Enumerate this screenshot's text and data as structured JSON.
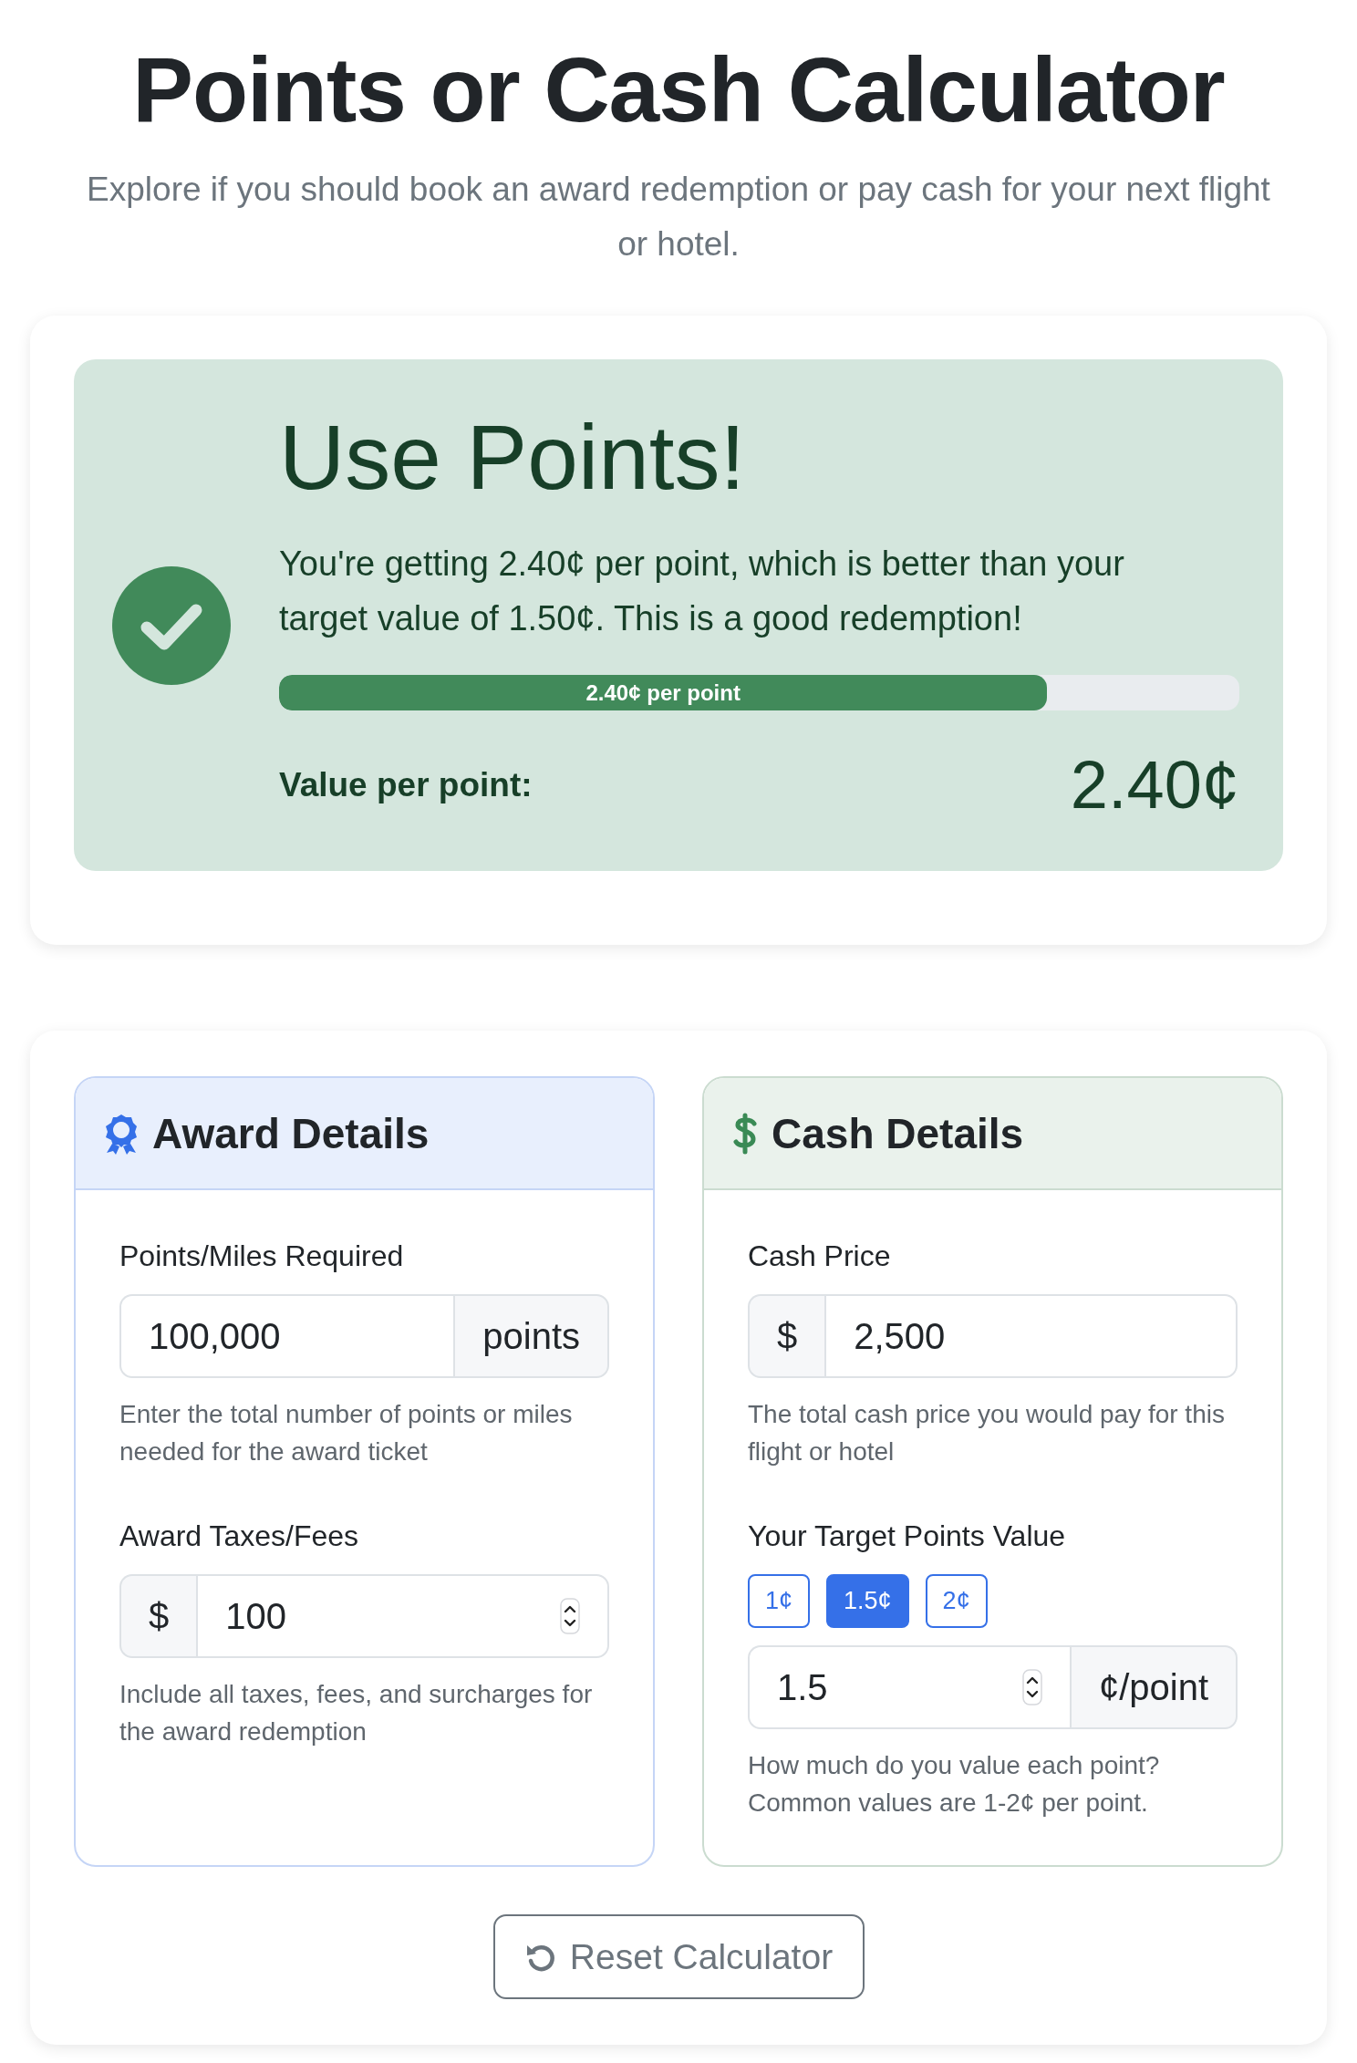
{
  "title": "Points or Cash Calculator",
  "subtitle": "Explore if you should book an award redemption or pay cash for your next flight or hotel.",
  "result": {
    "heading": "Use Points!",
    "message": "You're getting 2.40¢ per point, which is better than your target value of 1.50¢. This is a good redemption!",
    "progress": {
      "label": "2.40¢ per point",
      "level": 0.8
    },
    "value_label": "Value per point:",
    "value": "2.40¢"
  },
  "panels": [
    {
      "kind": "award",
      "title": "Award Details",
      "fields": [
        {
          "label": "Points/Miles Required",
          "value": "100,000",
          "suffix": "points",
          "spinner": false,
          "help": "Enter the total number of points or miles needed for the award ticket"
        },
        {
          "label": "Award Taxes/Fees",
          "prefix": "$",
          "value": "100",
          "spinner": true,
          "help": "Include all taxes, fees, and surcharges for the award redemption"
        }
      ]
    },
    {
      "kind": "cash",
      "title": "Cash Details",
      "fields": [
        {
          "label": "Cash Price",
          "prefix": "$",
          "value": "2,500",
          "spinner": false,
          "help": "The total cash price you would pay for this flight or hotel"
        },
        {
          "label": "Your Target Points Value",
          "presets": [
            {
              "label": "1¢",
              "selected": false
            },
            {
              "label": "1.5¢",
              "selected": true
            },
            {
              "label": "2¢",
              "selected": false
            }
          ],
          "value": "1.5",
          "suffix": "¢/point",
          "spinner": true,
          "help": "How much do you value each point? Common values are 1-2¢ per point."
        }
      ]
    }
  ],
  "reset_button": "Reset Calculator"
}
